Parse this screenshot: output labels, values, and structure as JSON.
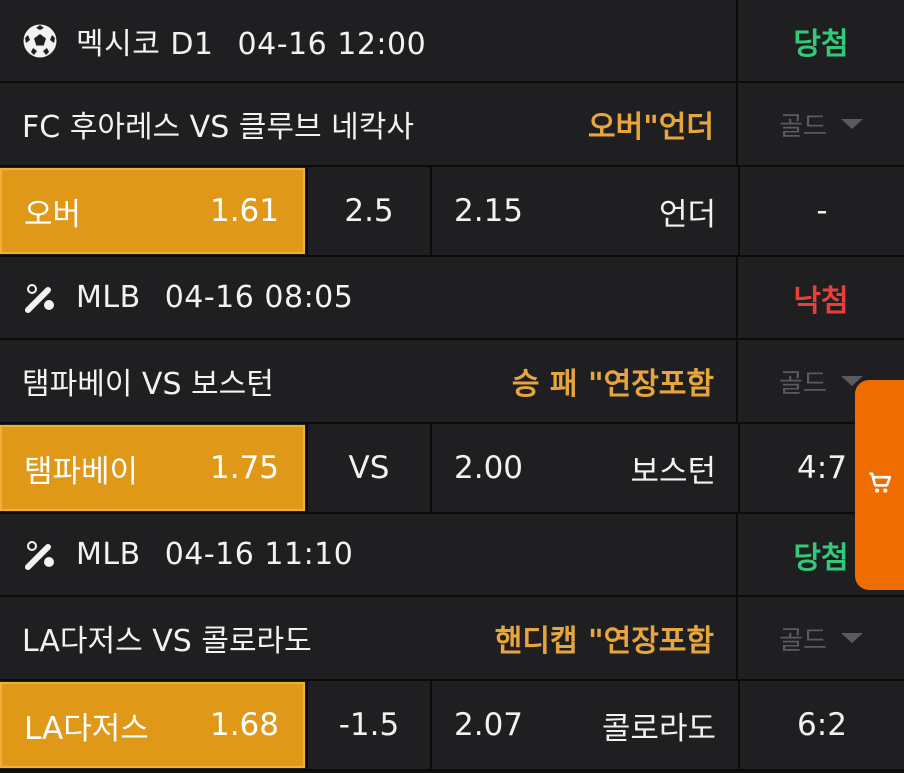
{
  "bets": [
    {
      "sport_icon": "soccer-ball-icon",
      "league": "멕시코 D1",
      "datetime": "04-16 12:00",
      "result": "당첨",
      "result_color": "#34c97a",
      "teams": "FC 후아레스 VS 클루브 네칵사",
      "bet_type": "오버\"언더",
      "gold_label": "골드",
      "home_label": "오버",
      "home_odds": "1.61",
      "middle": "2.5",
      "away_odds": "2.15",
      "away_label": "언더",
      "score": "-"
    },
    {
      "sport_icon": "baseball-bat-icon",
      "league": "MLB",
      "datetime": "04-16 08:05",
      "result": "낙첨",
      "result_color": "#e5413a",
      "teams": "탬파베이 VS 보스턴",
      "bet_type": "승 패 \"연장포함",
      "gold_label": "골드",
      "home_label": "탬파베이",
      "home_odds": "1.75",
      "middle": "VS",
      "away_odds": "2.00",
      "away_label": "보스턴",
      "score": "4:7"
    },
    {
      "sport_icon": "baseball-bat-icon",
      "league": "MLB",
      "datetime": "04-16 11:10",
      "result": "당첨",
      "result_color": "#34c97a",
      "teams": "LA다저스 VS 콜로라도",
      "bet_type": "핸디캡 \"연장포함",
      "gold_label": "골드",
      "home_label": "LA다저스",
      "home_odds": "1.68",
      "middle": "-1.5",
      "away_odds": "2.07",
      "away_label": "콜로라도",
      "score": "6:2"
    }
  ],
  "cart": {
    "icon": "cart-icon",
    "color": "#ef6c00"
  },
  "colors": {
    "accent": "#e09818",
    "bet_type": "#e7a53d",
    "background": "#1f1f21"
  }
}
